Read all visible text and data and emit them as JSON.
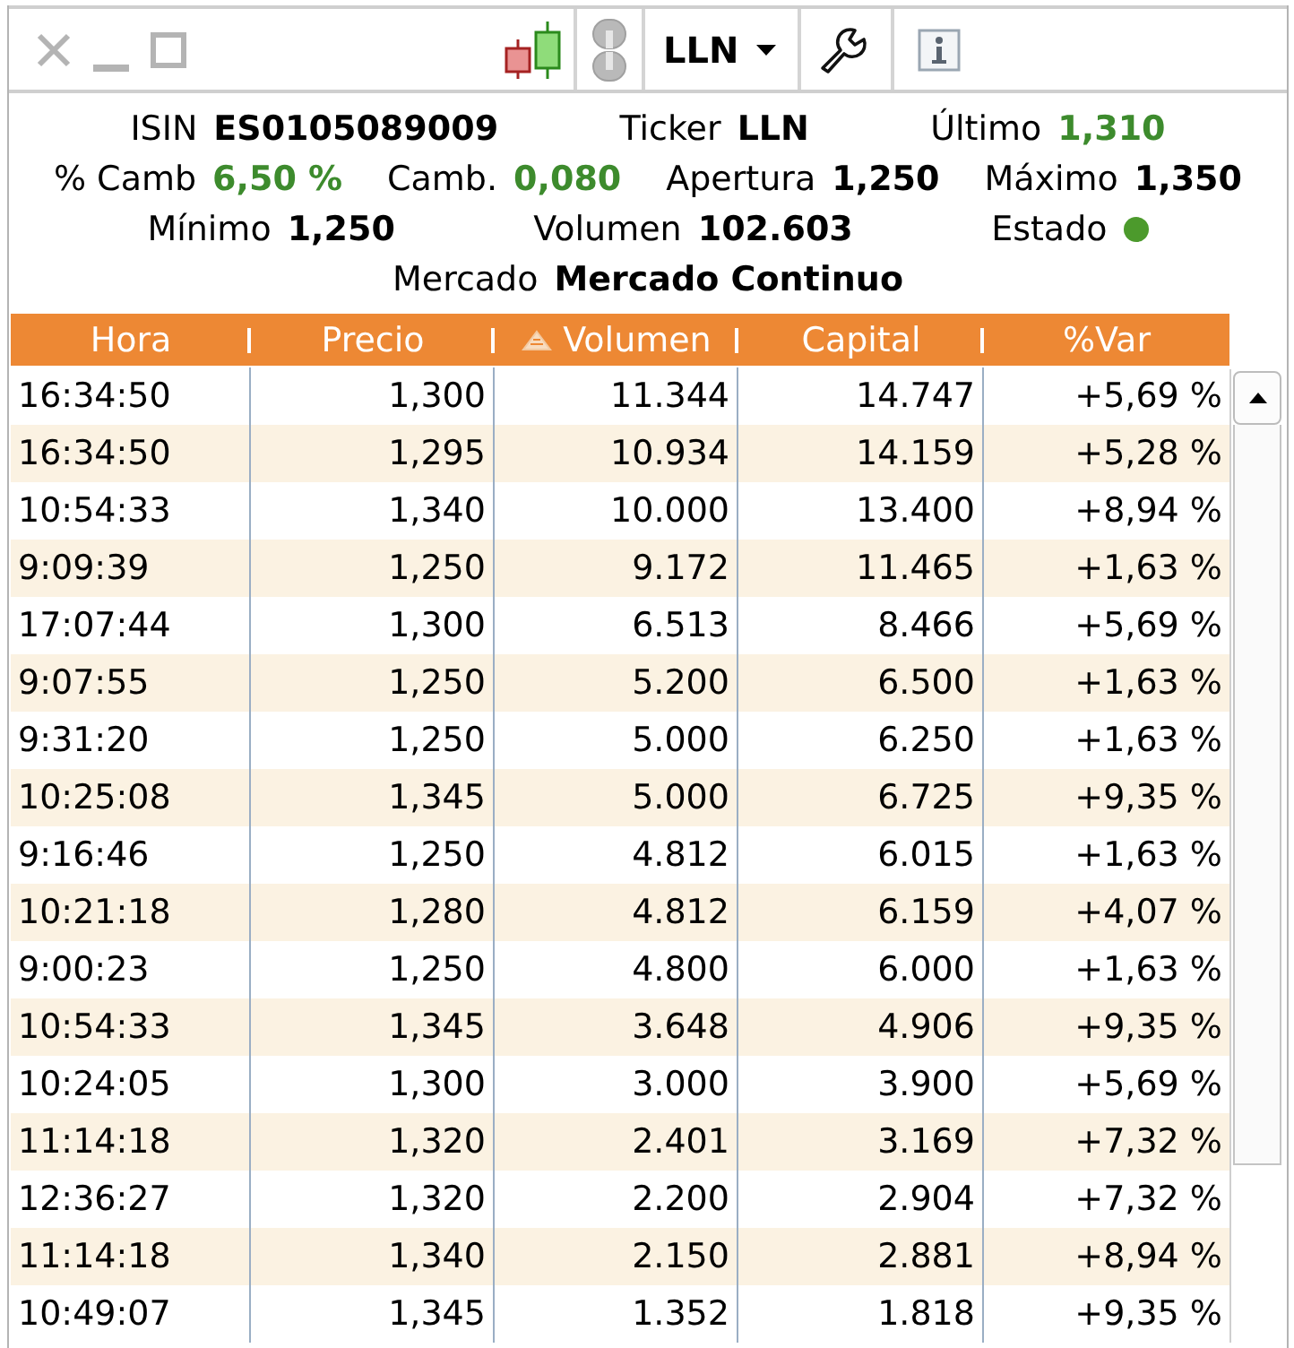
{
  "toolbar": {
    "window_controls": [
      {
        "kind": "close",
        "disabled": true
      },
      {
        "kind": "minimize",
        "disabled": true
      },
      {
        "kind": "maximize",
        "disabled": true
      }
    ],
    "symbol_menu": {
      "label": "LLN"
    }
  },
  "quote": {
    "lines": [
      [
        {
          "kind": "text",
          "label": "ISIN",
          "value": "ES0105089009",
          "color": "#000000"
        },
        {
          "kind": "text",
          "label": "Ticker",
          "value": "LLN",
          "color": "#000000"
        },
        {
          "kind": "text",
          "label": "Último",
          "value": "1,310",
          "color": "#3d8b2d"
        }
      ],
      [
        {
          "kind": "text",
          "label": "% Camb",
          "value": "6,50 %",
          "color": "#3d8b2d"
        },
        {
          "kind": "text",
          "label": "Camb.",
          "value": "0,080",
          "color": "#3d8b2d"
        },
        {
          "kind": "text",
          "label": "Apertura",
          "value": "1,250",
          "color": "#000000"
        },
        {
          "kind": "text",
          "label": "Máximo",
          "value": "1,350",
          "color": "#000000"
        }
      ],
      [
        {
          "kind": "text",
          "label": "Mínimo",
          "value": "1,250",
          "color": "#000000"
        },
        {
          "kind": "text",
          "label": "Volumen",
          "value": "102.603",
          "color": "#000000"
        },
        {
          "kind": "status",
          "label": "Estado",
          "color": "#4c9a2c"
        }
      ],
      [
        {
          "kind": "text",
          "label": "Mercado",
          "value": "Mercado Continuo",
          "color": "#000000"
        }
      ]
    ]
  },
  "table": {
    "columns": [
      {
        "label": "Hora",
        "sorted": false
      },
      {
        "label": "Precio",
        "sorted": false
      },
      {
        "label": "Volumen",
        "sorted": true
      },
      {
        "label": "Capital",
        "sorted": false
      },
      {
        "label": "%Var",
        "sorted": false
      }
    ],
    "rows": [
      [
        "16:34:50",
        "1,300",
        "11.344",
        "14.747",
        "+5,69 %"
      ],
      [
        "16:34:50",
        "1,295",
        "10.934",
        "14.159",
        "+5,28 %"
      ],
      [
        "10:54:33",
        "1,340",
        "10.000",
        "13.400",
        "+8,94 %"
      ],
      [
        "9:09:39",
        "1,250",
        "9.172",
        "11.465",
        "+1,63 %"
      ],
      [
        "17:07:44",
        "1,300",
        "6.513",
        "8.466",
        "+5,69 %"
      ],
      [
        "9:07:55",
        "1,250",
        "5.200",
        "6.500",
        "+1,63 %"
      ],
      [
        "9:31:20",
        "1,250",
        "5.000",
        "6.250",
        "+1,63 %"
      ],
      [
        "10:25:08",
        "1,345",
        "5.000",
        "6.725",
        "+9,35 %"
      ],
      [
        "9:16:46",
        "1,250",
        "4.812",
        "6.015",
        "+1,63 %"
      ],
      [
        "10:21:18",
        "1,280",
        "4.812",
        "6.159",
        "+4,07 %"
      ],
      [
        "9:00:23",
        "1,250",
        "4.800",
        "6.000",
        "+1,63 %"
      ],
      [
        "10:54:33",
        "1,345",
        "3.648",
        "4.906",
        "+9,35 %"
      ],
      [
        "10:24:05",
        "1,300",
        "3.000",
        "3.900",
        "+5,69 %"
      ],
      [
        "11:14:18",
        "1,320",
        "2.401",
        "3.169",
        "+7,32 %"
      ],
      [
        "12:36:27",
        "1,320",
        "2.200",
        "2.904",
        "+7,32 %"
      ],
      [
        "11:14:18",
        "1,340",
        "2.150",
        "2.881",
        "+8,94 %"
      ],
      [
        "10:49:07",
        "1,345",
        "1.352",
        "1.818",
        "+9,35 %"
      ]
    ]
  }
}
